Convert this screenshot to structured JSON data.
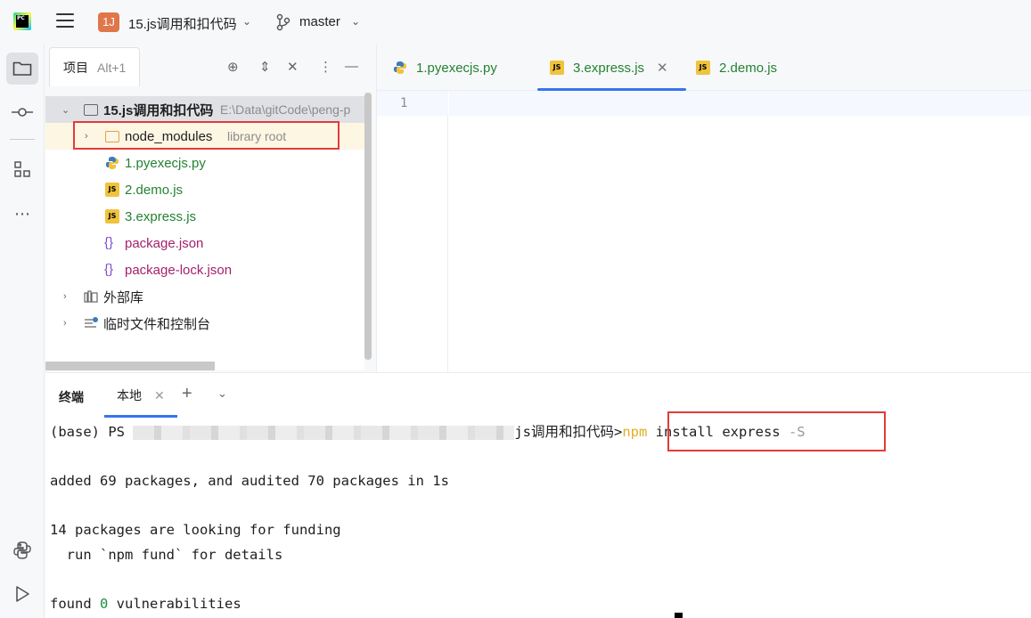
{
  "titlebar": {
    "app_logo_text": "PC",
    "project_badge": "1J",
    "project_name": "15.js调用和扣代码",
    "branch": "master"
  },
  "project_panel": {
    "tab_label": "项目",
    "tab_shortcut": "Alt+1",
    "tree": [
      {
        "label": "15.js调用和扣代码",
        "hint": "E:\\Data\\gitCode\\peng-p"
      },
      {
        "label": "node_modules",
        "hint": "library root"
      },
      {
        "label": "1.pyexecjs.py"
      },
      {
        "label": "2.demo.js"
      },
      {
        "label": "3.express.js"
      },
      {
        "label": "package.json"
      },
      {
        "label": "package-lock.json"
      },
      {
        "label": "外部库"
      },
      {
        "label": "临时文件和控制台"
      }
    ]
  },
  "editor": {
    "tabs": [
      {
        "label": "1.pyexecjs.py",
        "icon": "python-icon"
      },
      {
        "label": "3.express.js",
        "icon": "js-icon",
        "active": true
      },
      {
        "label": "2.demo.js",
        "icon": "js-icon"
      }
    ],
    "line_numbers": [
      "1"
    ]
  },
  "terminal": {
    "title": "终端",
    "tab_label": "本地",
    "prompt_prefix": "(base) PS ",
    "prompt_suffix": "js调用和扣代码>",
    "cmd_npm": "npm",
    "cmd_rest": " install express ",
    "cmd_flag": "-S",
    "lines": {
      "added": "added 69 packages, and audited 70 packages in 1s",
      "funding": "14 packages are looking for funding",
      "fund_hint": "  run `npm fund` for details",
      "found_a": "found ",
      "found_zero": "0",
      "found_b": " vulnerabilities"
    }
  },
  "colors": {
    "accent": "#3574f0",
    "highlight_box": "#e33b3b",
    "vcs_added": "#248232",
    "json_file": "#a3216d"
  }
}
